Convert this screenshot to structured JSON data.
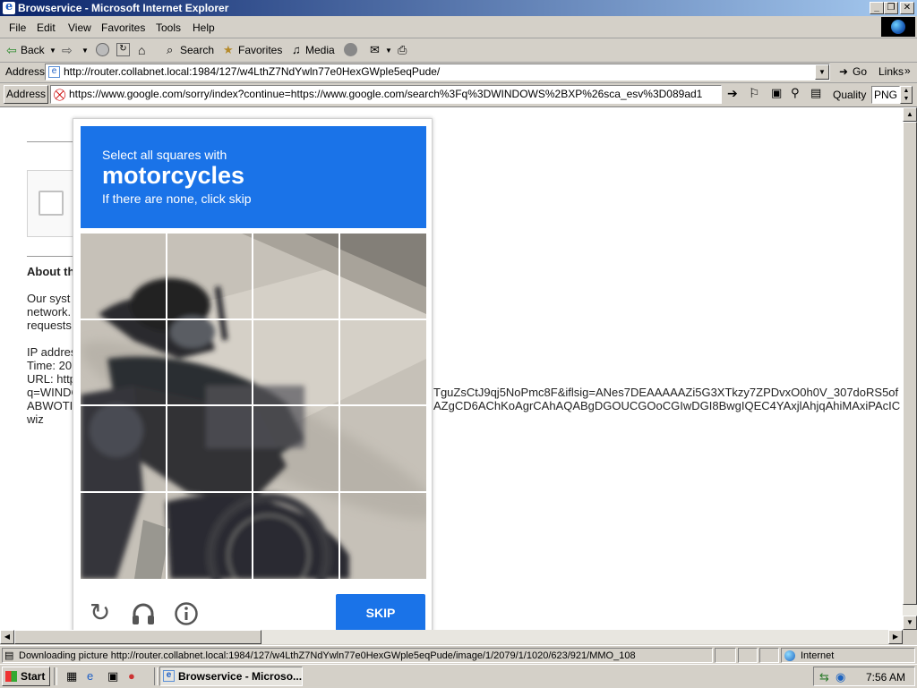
{
  "window": {
    "title": "Browservice - Microsoft Internet Explorer"
  },
  "menubar": {
    "items": [
      "File",
      "Edit",
      "View",
      "Favorites",
      "Tools",
      "Help"
    ]
  },
  "toolbar": {
    "back": "Back",
    "search": "Search",
    "favorites": "Favorites",
    "media": "Media"
  },
  "address_bar": {
    "label": "Address",
    "url": "http://router.collabnet.local:1984/127/w4LthZ7NdYwln77e0HexGWple5eqPude/",
    "go": "Go",
    "links": "Links"
  },
  "inner_address_bar": {
    "label": "Address",
    "url": "https://www.google.com/sorry/index?continue=https://www.google.com/search%3Fq%3DWINDOWS%2BXP%26sca_esv%3D089ad1",
    "quality_label": "Quality",
    "quality_value": "PNG"
  },
  "page": {
    "about_heading": "About th",
    "para_lines": [
      "Our syst",
      "network.",
      "requests"
    ],
    "info_lines": [
      "IP addres",
      "Time: 20",
      "URL: http",
      "q=WINDO",
      "ABWOTI",
      "wiz"
    ],
    "right_line1": "TguZsCtJ9qj5NoPmc8F&iflsig=ANes7DEAAAAAZi5G3XTkzy7ZPDvxO0h0V_307doRS5of",
    "right_line2": "AZgCD6AChKoAgrCAhAQABgDGOUCGOoCGIwDGI8BwgIQEC4YAxjlAhjqAhiMAxiPAcIC"
  },
  "captcha": {
    "instruction": "Select all squares with",
    "target": "motorcycles",
    "hint": "If there are none, click skip",
    "skip_button": "SKIP",
    "grid_rows": 4,
    "grid_cols": 4,
    "icons": [
      "reload-icon",
      "audio-icon",
      "info-icon"
    ]
  },
  "statusbar": {
    "text": "Downloading picture http://router.collabnet.local:1984/127/w4LthZ7NdYwln77e0HexGWple5eqPude/image/1/2079/1/1020/623/921/MMO_108",
    "zone": "Internet"
  },
  "taskbar": {
    "start": "Start",
    "task": "Browservice - Microso...",
    "clock": "7:56 AM"
  }
}
